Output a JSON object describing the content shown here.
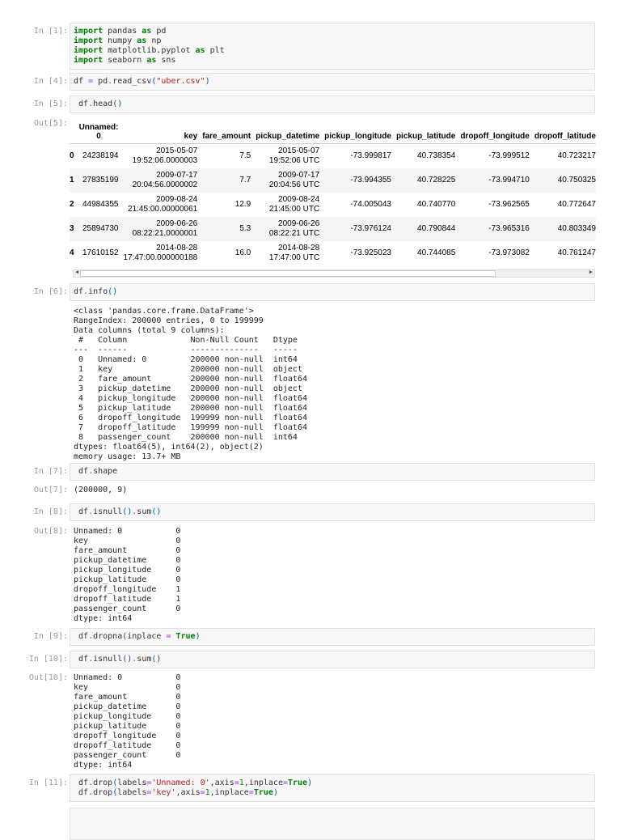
{
  "cells": [
    {
      "prompt": "In [1]:",
      "lines": [
        [
          [
            "import",
            "kw"
          ],
          [
            " pandas ",
            ""
          ],
          [
            "as",
            "kw"
          ],
          [
            " pd",
            ""
          ]
        ],
        [
          [
            "import",
            "kw"
          ],
          [
            " numpy ",
            ""
          ],
          [
            "as",
            "kw"
          ],
          [
            " np",
            ""
          ]
        ],
        [
          [
            "import",
            "kw"
          ],
          [
            " matplotlib.pyplot ",
            ""
          ],
          [
            "as",
            "kw"
          ],
          [
            " plt",
            ""
          ]
        ],
        [
          [
            "import",
            "kw"
          ],
          [
            " seaborn ",
            ""
          ],
          [
            "as",
            "kw"
          ],
          [
            " sns",
            ""
          ]
        ]
      ]
    },
    {
      "prompt": "In [4]:",
      "lines": [
        [
          [
            "df ",
            ""
          ],
          [
            "=",
            "op"
          ],
          [
            " pd",
            ""
          ],
          [
            ".",
            "op"
          ],
          [
            "read_csv",
            ""
          ],
          [
            "(",
            "paren"
          ],
          [
            "\"uber.csv\"",
            "str"
          ],
          [
            ")",
            "paren"
          ]
        ]
      ]
    },
    {
      "prompt": "In [5]:",
      "lines": [
        [
          [
            " df",
            ""
          ],
          [
            ".",
            "op"
          ],
          [
            "head",
            ""
          ],
          [
            "()",
            "paren"
          ]
        ]
      ]
    },
    {
      "prompt": "In [6]:",
      "lines": [
        [
          [
            "df",
            ""
          ],
          [
            ".",
            "op"
          ],
          [
            "info",
            ""
          ],
          [
            "()",
            "paren"
          ]
        ]
      ]
    },
    {
      "prompt": "In [7]:",
      "lines": [
        [
          [
            " df",
            ""
          ],
          [
            ".",
            "op"
          ],
          [
            "shape",
            ""
          ]
        ]
      ]
    },
    {
      "prompt": "In [8]:",
      "lines": [
        [
          [
            " df",
            ""
          ],
          [
            ".",
            "op"
          ],
          [
            "isnull",
            ""
          ],
          [
            "()",
            "paren"
          ],
          [
            ".",
            "op"
          ],
          [
            "sum",
            ""
          ],
          [
            "()",
            "paren"
          ]
        ]
      ]
    },
    {
      "prompt": "In [9]:",
      "lines": [
        [
          [
            " df",
            ""
          ],
          [
            ".",
            "op"
          ],
          [
            "dropna",
            ""
          ],
          [
            "(",
            "paren"
          ],
          [
            "inplace ",
            ""
          ],
          [
            "=",
            "op"
          ],
          [
            " ",
            ""
          ],
          [
            "True",
            "kw"
          ],
          [
            ")",
            "paren"
          ]
        ]
      ]
    },
    {
      "prompt": "In [10]:",
      "lines": [
        [
          [
            " df",
            ""
          ],
          [
            ".",
            "op"
          ],
          [
            "isnull",
            ""
          ],
          [
            "()",
            "paren"
          ],
          [
            ".",
            "op"
          ],
          [
            "sum",
            ""
          ],
          [
            "()",
            "paren"
          ]
        ]
      ]
    },
    {
      "prompt": "In [11]:",
      "lines": [
        [
          [
            " df",
            ""
          ],
          [
            ".",
            "op"
          ],
          [
            "drop",
            ""
          ],
          [
            "(",
            "paren"
          ],
          [
            "labels",
            ""
          ],
          [
            "=",
            "op"
          ],
          [
            "'Unnamed: 0'",
            "str"
          ],
          [
            ",axis",
            ""
          ],
          [
            "=",
            "op"
          ],
          [
            "1",
            "num"
          ],
          [
            ",inplace",
            ""
          ],
          [
            "=",
            "op"
          ],
          [
            "True",
            "kw"
          ],
          [
            ")",
            "paren"
          ]
        ],
        [
          [
            " df",
            ""
          ],
          [
            ".",
            "op"
          ],
          [
            "drop",
            ""
          ],
          [
            "(",
            "paren"
          ],
          [
            "labels",
            ""
          ],
          [
            "=",
            "op"
          ],
          [
            "'key'",
            "str"
          ],
          [
            ",axis",
            ""
          ],
          [
            "=",
            "op"
          ],
          [
            "1",
            "num"
          ],
          [
            ",inplace",
            ""
          ],
          [
            "=",
            "op"
          ],
          [
            "True",
            "kw"
          ],
          [
            ")",
            "paren"
          ]
        ]
      ]
    },
    {
      "prompt": "",
      "lines": []
    }
  ],
  "outputs": {
    "out5": {
      "prompt": "Out[5]:",
      "columns": [
        "",
        "Unnamed: 0",
        "key",
        "fare_amount",
        "pickup_datetime",
        "pickup_longitude",
        "pickup_latitude",
        "dropoff_longitude",
        "dropoff_latitude"
      ],
      "rows": [
        [
          "0",
          "24238194",
          "2015-05-07 19:52:06.0000003",
          "7.5",
          "2015-05-07 19:52:06 UTC",
          "-73.999817",
          "40.738354",
          "-73.999512",
          "40.723217"
        ],
        [
          "1",
          "27835199",
          "2009-07-17 20:04:56.0000002",
          "7.7",
          "2009-07-17 20:04:56 UTC",
          "-73.994355",
          "40.728225",
          "-73.994710",
          "40.750325"
        ],
        [
          "2",
          "44984355",
          "2009-08-24 21:45:00.00000061",
          "12.9",
          "2009-08-24 21:45:00 UTC",
          "-74.005043",
          "40.740770",
          "-73.962565",
          "40.772647"
        ],
        [
          "3",
          "25894730",
          "2009-06-26 08:22:21.0000001",
          "5.3",
          "2009-06-26 08:22:21 UTC",
          "-73.976124",
          "40.790844",
          "-73.965316",
          "40.803349"
        ],
        [
          "4",
          "17610152",
          "2014-08-28 17:47:00.000000188",
          "16.0",
          "2014-08-28 17:47:00 UTC",
          "-73.925023",
          "40.744085",
          "-73.973082",
          "40.761247"
        ]
      ]
    },
    "out6": {
      "text": "<class 'pandas.core.frame.DataFrame'>\nRangeIndex: 200000 entries, 0 to 199999\nData columns (total 9 columns):\n #   Column             Non-Null Count   Dtype  \n---  ------             --------------   -----  \n 0   Unnamed: 0         200000 non-null  int64  \n 1   key                200000 non-null  object \n 2   fare_amount        200000 non-null  float64\n 3   pickup_datetime    200000 non-null  object \n 4   pickup_longitude   200000 non-null  float64\n 5   pickup_latitude    200000 non-null  float64\n 6   dropoff_longitude  199999 non-null  float64\n 7   dropoff_latitude   199999 non-null  float64\n 8   passenger_count    200000 non-null  int64  \ndtypes: float64(5), int64(2), object(2)\nmemory usage: 13.7+ MB"
    },
    "out7": {
      "prompt": "Out[7]:",
      "text": "(200000, 9)"
    },
    "out8": {
      "prompt": "Out[8]:",
      "text": "Unnamed: 0           0\nkey                  0\nfare_amount          0\npickup_datetime      0\npickup_longitude     0\npickup_latitude      0\ndropoff_longitude    1\ndropoff_latitude     1\npassenger_count      0\ndtype: int64"
    },
    "out10": {
      "prompt": "Out[10]:",
      "text": "Unnamed: 0           0\nkey                  0\nfare_amount          0\npickup_datetime      0\npickup_longitude     0\npickup_latitude      0\ndropoff_longitude    0\ndropoff_latitude     0\npassenger_count      0\ndtype: int64"
    }
  }
}
